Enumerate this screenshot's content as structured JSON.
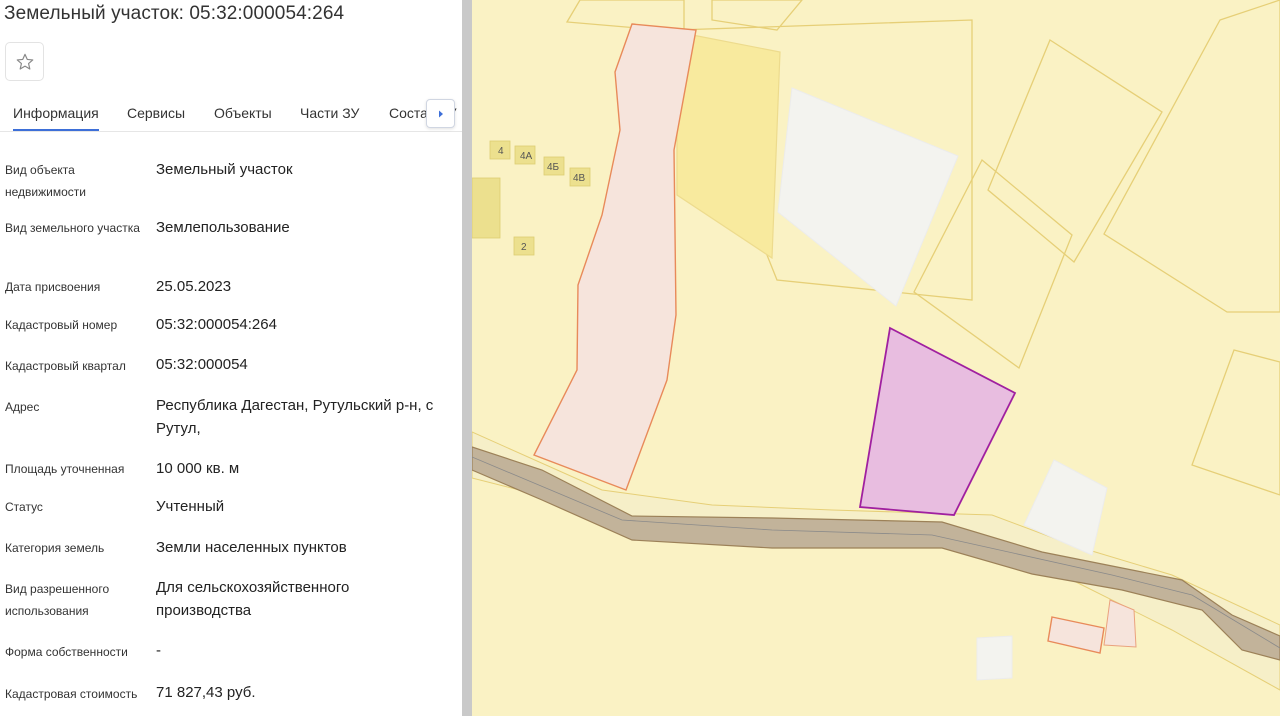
{
  "header": {
    "title": "Земельный участок: 05:32:000054:264"
  },
  "toolbar": {
    "favorite_icon": "star-outline-icon"
  },
  "tabs": [
    {
      "label": "Информация",
      "active": true
    },
    {
      "label": "Сервисы"
    },
    {
      "label": "Объекты"
    },
    {
      "label": "Части ЗУ"
    },
    {
      "label": "Состав ЗУ"
    }
  ],
  "tabs_next_icon": "caret-right-icon",
  "info": [
    {
      "label": "Вид объекта недвижимости",
      "value": "Земельный участок"
    },
    {
      "label": "Вид земельного участка",
      "value": "Землепользование"
    },
    {
      "label": "Дата присвоения",
      "value": "25.05.2023"
    },
    {
      "label": "Кадастровый номер",
      "value": "05:32:000054:264"
    },
    {
      "label": "Кадастровый квартал",
      "value": "05:32:000054"
    },
    {
      "label": "Адрес",
      "value": "Республика Дагестан, Рутульский р-н, с Рутул,"
    },
    {
      "label": "Площадь уточненная",
      "value": "10 000 кв. м"
    },
    {
      "label": "Статус",
      "value": "Учтенный"
    },
    {
      "label": "Категория земель",
      "value": "Земли населенных пунктов"
    },
    {
      "label": "Вид разрешенного использования",
      "value": "Для сельскохозяйственного производства"
    },
    {
      "label": "Форма собственности",
      "value": "-"
    },
    {
      "label": "Кадастровая стоимость",
      "value": "71 827,43 руб."
    }
  ],
  "map": {
    "building_labels": [
      "4",
      "4А",
      "4Б",
      "4В",
      "2"
    ],
    "colors": {
      "background": "#faf2c4",
      "selected_parcel_fill": "#e8bde0",
      "selected_parcel_stroke": "#a020a0",
      "parcel_outline": "#e8d27a",
      "road_fill": "#c2b39a",
      "pink_parcel_stroke": "#e88a5a"
    }
  }
}
